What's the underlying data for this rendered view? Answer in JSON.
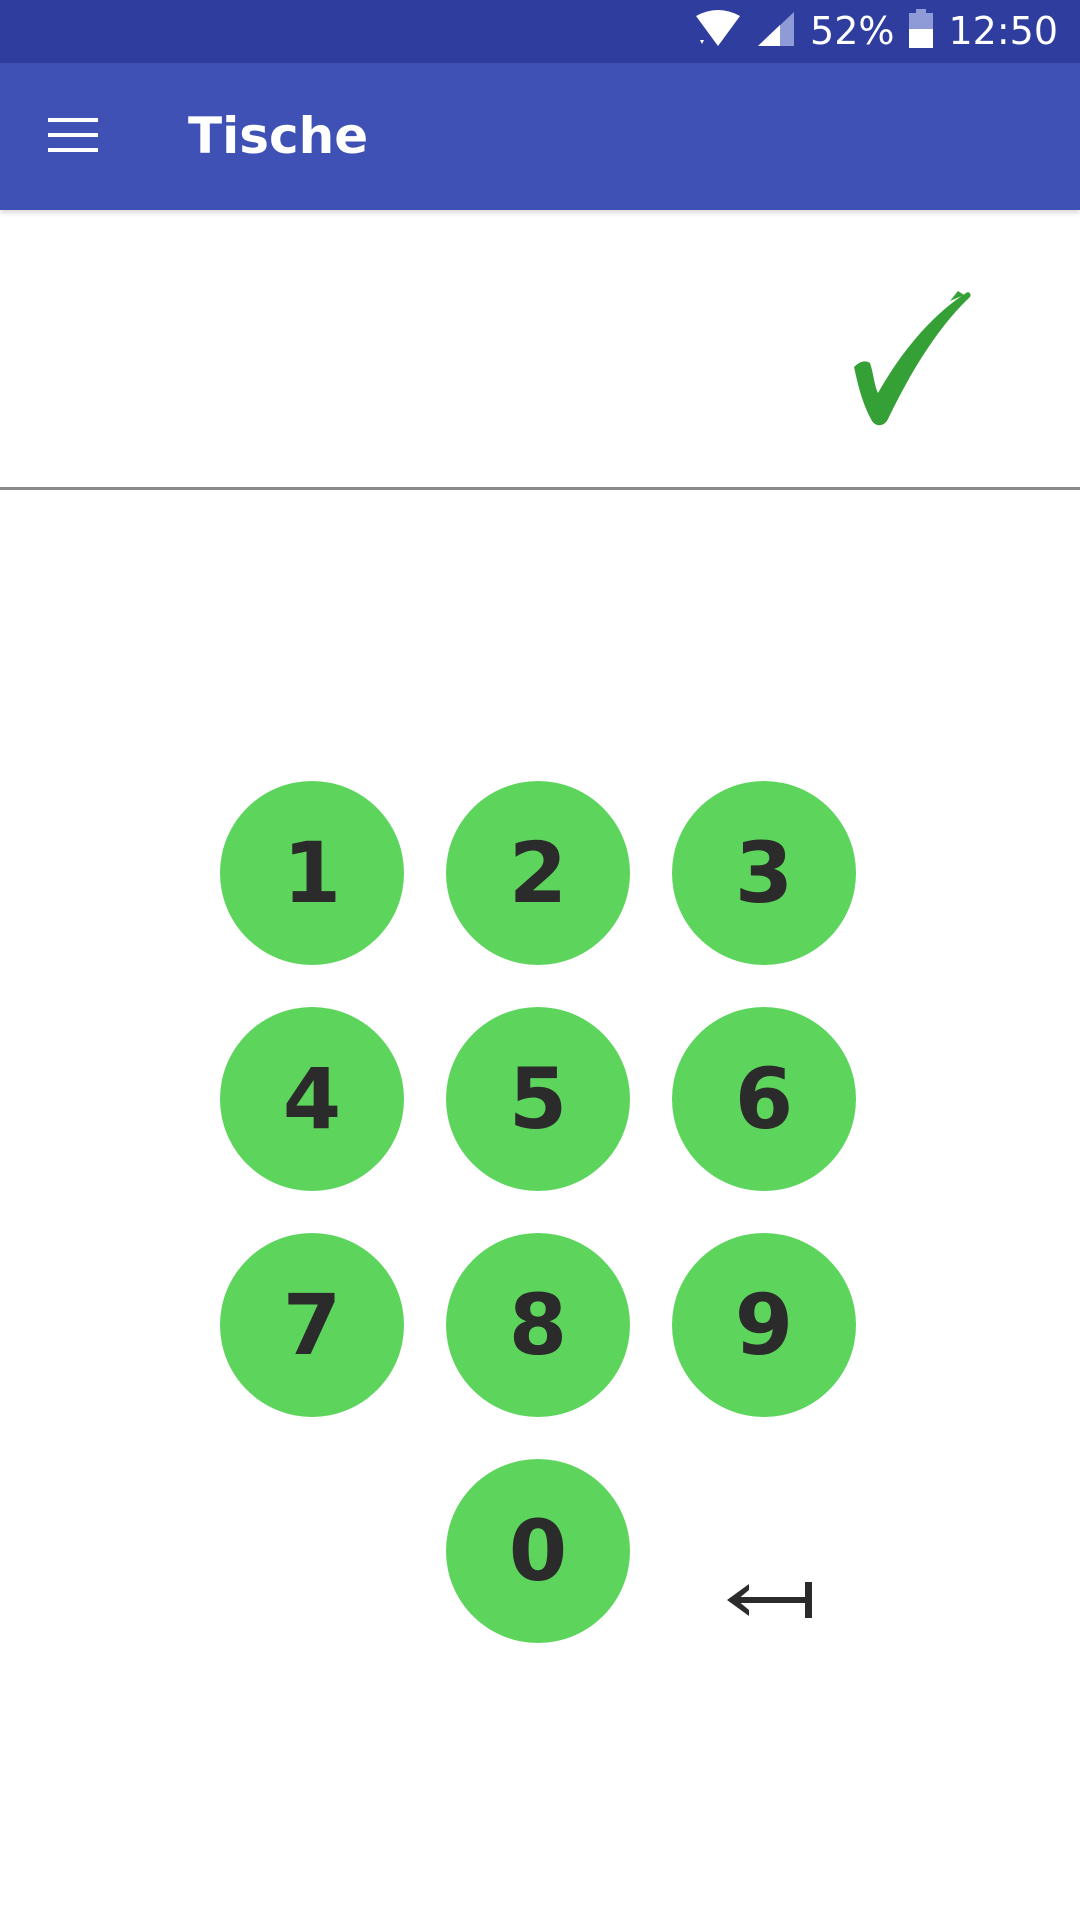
{
  "status_bar": {
    "battery": "52%",
    "time": "12:50",
    "icons": [
      "wifi-icon",
      "cell-signal-icon",
      "battery-icon"
    ]
  },
  "app_bar": {
    "title": "Tische",
    "menu_icon": "menu-icon"
  },
  "input": {
    "value": "",
    "confirm_icon": "checkmark-icon"
  },
  "keypad": {
    "keys": [
      "1",
      "2",
      "3",
      "4",
      "5",
      "6",
      "7",
      "8",
      "9",
      "0"
    ],
    "backspace_icon": "backspace-arrow-icon"
  },
  "colors": {
    "status_bar": "#2f3e9e",
    "app_bar": "#3f51b5",
    "key": "#5dd55d",
    "key_text": "#2b2b2b",
    "check": "#35a035"
  }
}
